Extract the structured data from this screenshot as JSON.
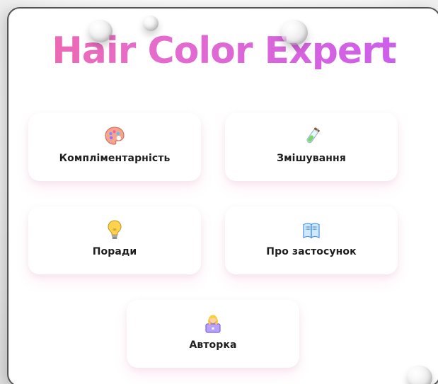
{
  "app": {
    "title": "Hair Color Expert"
  },
  "menu": {
    "items": [
      {
        "id": "complementarity",
        "label": "Компліментарність",
        "icon": "palette-icon"
      },
      {
        "id": "mixing",
        "label": "Змішування",
        "icon": "test-tube-icon"
      },
      {
        "id": "tips",
        "label": "Поради",
        "icon": "lightbulb-icon"
      },
      {
        "id": "about",
        "label": "Про застосунок",
        "icon": "book-icon"
      },
      {
        "id": "author",
        "label": "Авторка",
        "icon": "author-icon"
      }
    ]
  },
  "colors": {
    "title_gradient_start": "#f06aa8",
    "title_gradient_mid": "#e56bcd",
    "title_gradient_end": "#c85cf0",
    "tile_bg": "#ffffff",
    "tile_text": "#1f1f1f"
  }
}
